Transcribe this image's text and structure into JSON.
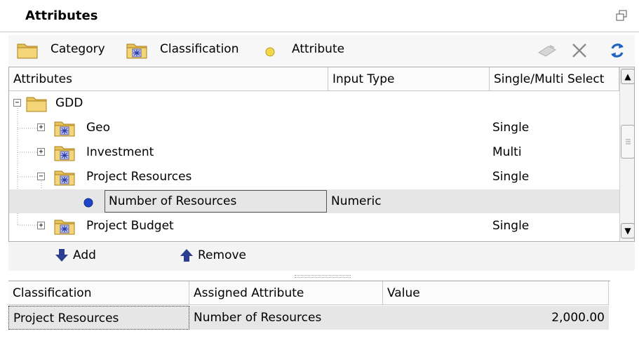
{
  "panel": {
    "title": "Attributes"
  },
  "toolbar": {
    "category_label": "Category",
    "classification_label": "Classification",
    "attribute_label": "Attribute"
  },
  "tree": {
    "columns": [
      "Attributes",
      "Input Type",
      "Single/Multi Select"
    ],
    "rows": [
      {
        "label": "GDD",
        "input_type": "",
        "select": ""
      },
      {
        "label": "Geo",
        "input_type": "",
        "select": "Single"
      },
      {
        "label": "Investment",
        "input_type": "",
        "select": "Multi"
      },
      {
        "label": "Project Resources",
        "input_type": "",
        "select": "Single"
      },
      {
        "label": "Number of Resources",
        "input_type": "Numeric",
        "select": ""
      },
      {
        "label": "Project Budget",
        "input_type": "",
        "select": "Single"
      }
    ]
  },
  "actions": {
    "add_label": "Add",
    "remove_label": "Remove"
  },
  "grid": {
    "columns": [
      "Classification",
      "Assigned Attribute",
      "Value"
    ],
    "rows": [
      {
        "classification": "Project Resources",
        "attribute": "Number of Resources",
        "value": "2,000.00"
      }
    ]
  },
  "colors": {
    "folder": "#e8c25a",
    "attribute_dot": "#f0d84a",
    "selected_dot": "#1f46c8",
    "refresh": "#1e62c8"
  }
}
